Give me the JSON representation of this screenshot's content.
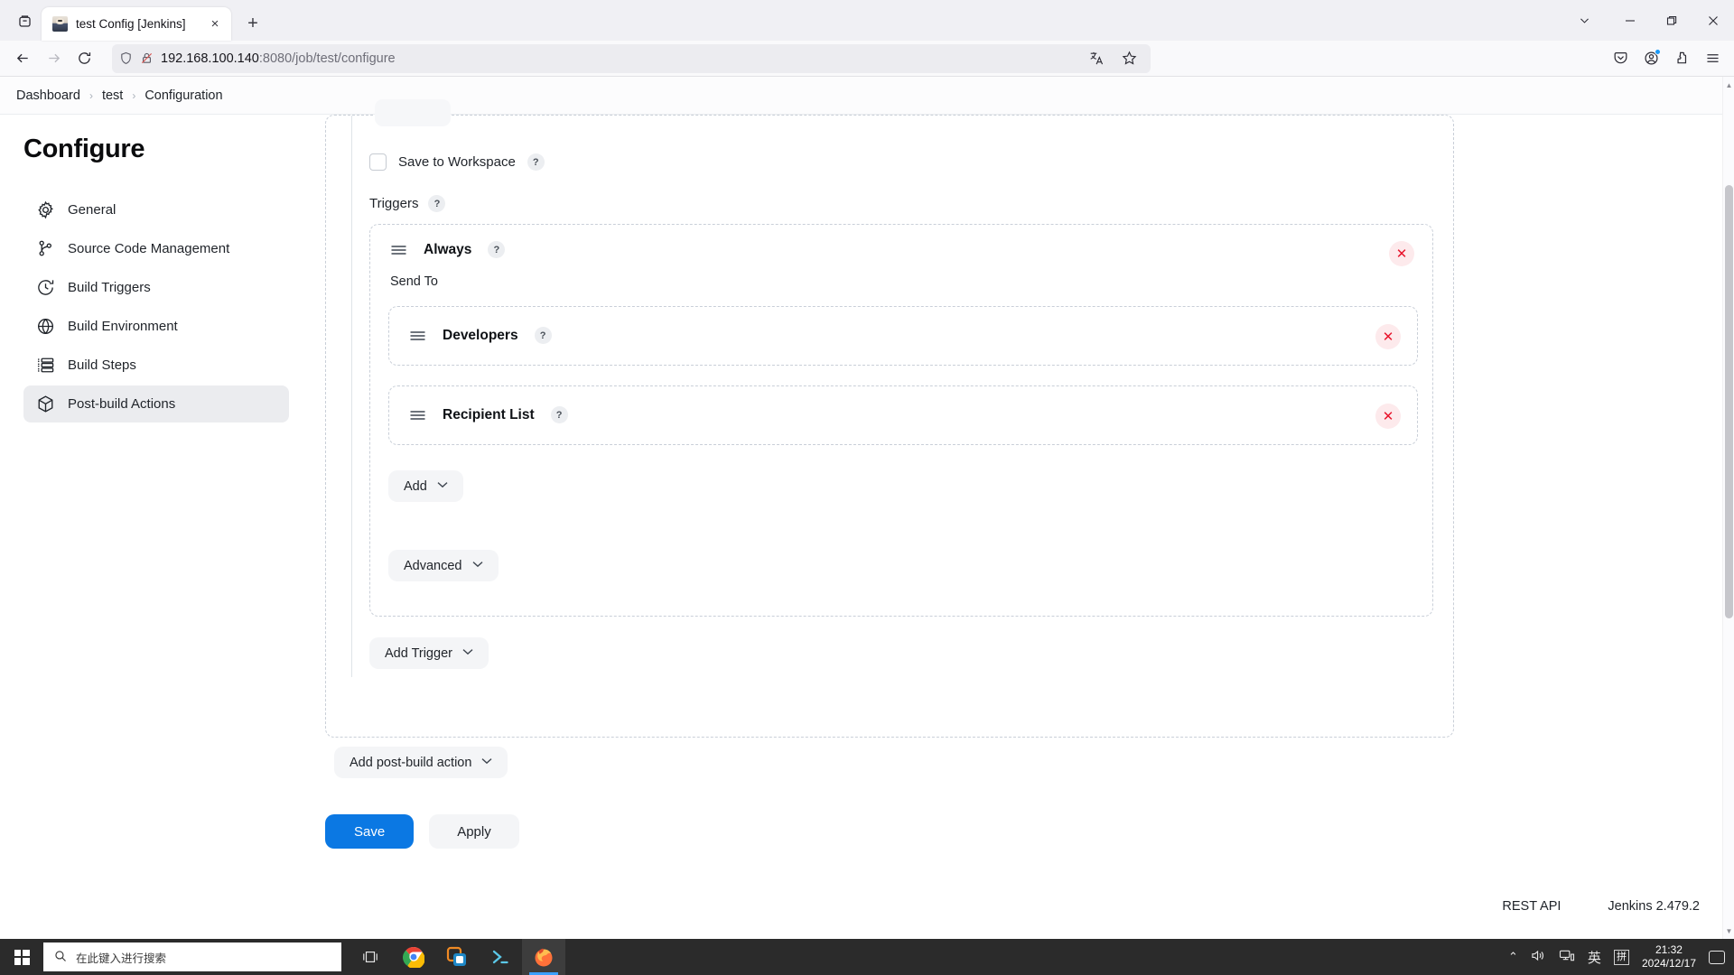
{
  "browser": {
    "tab": {
      "title": "test Config [Jenkins]",
      "favicon": "jenkins-favicon",
      "close_label": "×"
    },
    "newtab_label": "+",
    "window_controls": {
      "chevron": "⌄",
      "minimize": "─",
      "maximize": "❐",
      "close": "✕"
    },
    "nav": {
      "back": "←",
      "forward": "→",
      "reload": "↻"
    },
    "url": {
      "host": "192.168.100.140",
      "path": ":8080/job/test/configure"
    },
    "urlbar_icons": [
      "translate-icon",
      "bookmark-star-icon"
    ],
    "toolbar_icons": [
      "pocket-icon",
      "account-icon",
      "extensions-icon",
      "app-menu-icon"
    ]
  },
  "breadcrumb": {
    "items": [
      "Dashboard",
      "test",
      "Configuration"
    ],
    "separator": "›"
  },
  "sidebar": {
    "title": "Configure",
    "items": [
      {
        "label": "General",
        "icon": "gear-icon",
        "active": false
      },
      {
        "label": "Source Code Management",
        "icon": "branch-icon",
        "active": false
      },
      {
        "label": "Build Triggers",
        "icon": "clock-arrow-icon",
        "active": false
      },
      {
        "label": "Build Environment",
        "icon": "globe-icon",
        "active": false
      },
      {
        "label": "Build Steps",
        "icon": "list-icon",
        "active": false
      },
      {
        "label": "Post-build Actions",
        "icon": "package-icon",
        "active": true
      }
    ]
  },
  "form": {
    "save_to_workspace": {
      "label": "Save to Workspace",
      "checked": false,
      "help": "?"
    },
    "triggers": {
      "label": "Triggers",
      "help": "?"
    },
    "trigger": {
      "title": "Always",
      "help": "?",
      "grip": "drag-handle-icon",
      "delete": "✕",
      "send_to_label": "Send To",
      "recipients": [
        {
          "title": "Developers",
          "help": "?",
          "grip": "drag-handle-icon",
          "delete": "✕"
        },
        {
          "title": "Recipient List",
          "help": "?",
          "grip": "drag-handle-icon",
          "delete": "✕"
        }
      ],
      "add_button": "Add",
      "advanced_button": "Advanced"
    },
    "add_trigger_button": "Add Trigger",
    "add_post_build_button": "Add post-build action",
    "chevron": "⌄"
  },
  "actions": {
    "save": "Save",
    "apply": "Apply",
    "save_color": "#0b78e3"
  },
  "footer": {
    "rest_api": "REST API",
    "version": "Jenkins 2.479.2"
  },
  "taskbar": {
    "start": "windows-start-icon",
    "search_placeholder": "在此键入进行搜索",
    "apps": [
      "task-view-icon",
      "chrome-icon",
      "vmware-icon",
      "powershell-icon",
      "firefox-icon"
    ],
    "tray": {
      "chevron": "⌃",
      "volume": "🔊",
      "network": "network-icon",
      "ime_lang": "英",
      "ime_mode": "拼"
    },
    "clock": {
      "time": "21:32",
      "date": "2024/12/17"
    },
    "notifications": "notification-icon"
  }
}
